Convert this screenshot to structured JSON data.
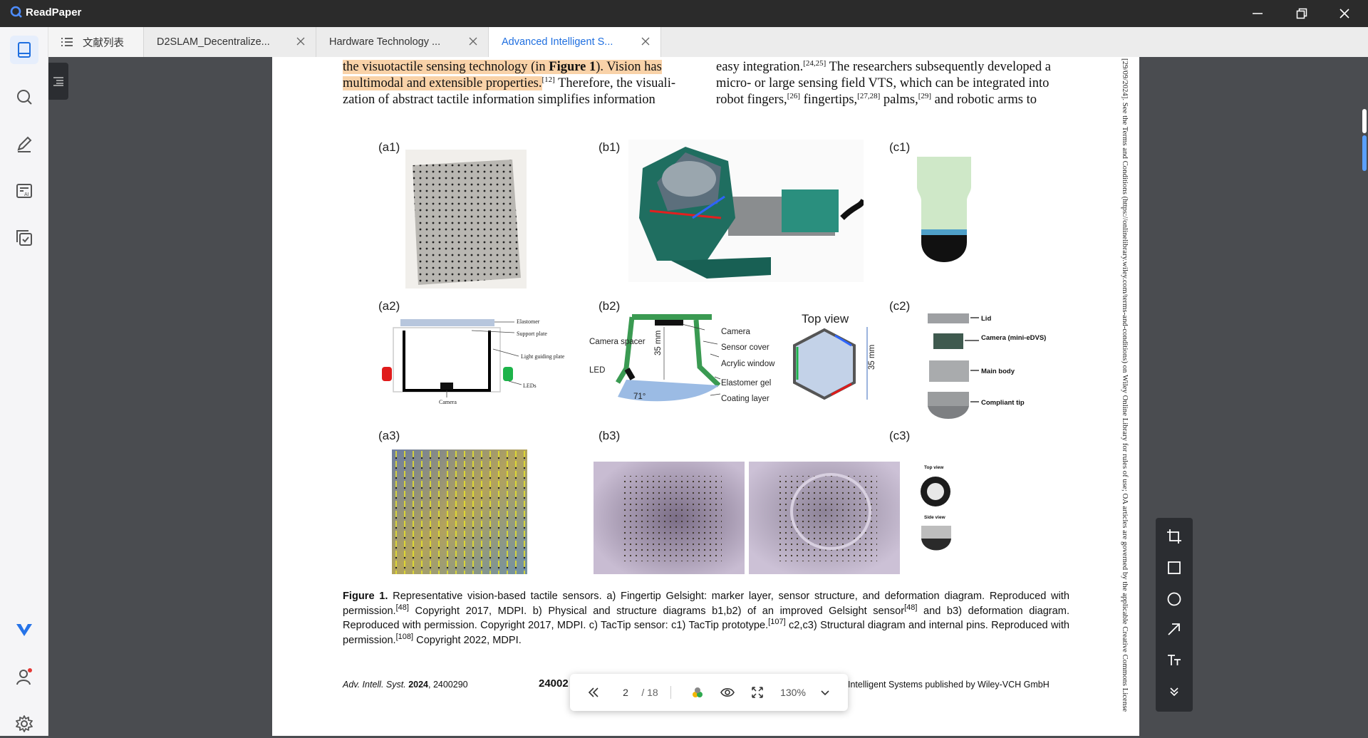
{
  "app": {
    "name": "ReadPaper"
  },
  "tabs": [
    {
      "label": "文献列表"
    },
    {
      "label": "D2SLAM_Decentralize..."
    },
    {
      "label": "Hardware Technology ..."
    },
    {
      "label": "Advanced Intelligent S..."
    }
  ],
  "paper": {
    "left_col": {
      "l1_hl": "the visuotactile sensing technology (in ",
      "l1_fig": "Figure 1",
      "l1_rest": "). Vision has",
      "l2_hl": "multimodal and extensible properties.",
      "l2_ref": "[12]",
      "l2_rest": " Therefore, the visuali-",
      "l3": "zation of abstract tactile information simplifies information"
    },
    "right_col": {
      "r1": "easy integration.",
      "r1_ref": "[24,25]",
      "r1_rest": " The researchers subsequently developed a",
      "r2": "micro- or large sensing field VTS, which can be integrated into",
      "r3a": "robot fingers,",
      "r3_ref1": "[26]",
      "r3b": " fingertips,",
      "r3_ref2": "[27,28]",
      "r3c": " palms,",
      "r3_ref3": "[29]",
      "r3d": " and robotic arms to"
    },
    "side_text": "[29/09/2024]. See the Terms and Conditions (https://onlinelibrary.wiley.com/terms-and-conditions) on Wiley Online Library for rules of use; OA articles are governed by the applicable Creative Commons License",
    "figure": {
      "labels": [
        "(a1)",
        "(b1)",
        "(c1)",
        "(a2)",
        "(b2)",
        "(c2)",
        "(a3)",
        "(b3)",
        "(c3)"
      ],
      "a2": [
        "Elastomer",
        "Support plate",
        "Light guiding plate",
        "LEDs",
        "Camera"
      ],
      "b2": [
        "Camera",
        "Sensor cover",
        "Acrylic window",
        "Elastomer gel",
        "Coating layer",
        "Camera spacer",
        "LED",
        "35 mm",
        "71°",
        "Top view",
        "35 mm"
      ],
      "c2": [
        "Lid",
        "Camera (mini-eDVS)",
        "Main body",
        "Compliant tip"
      ],
      "c3": [
        "Top view",
        "Side view"
      ]
    },
    "caption": {
      "label": "Figure 1.",
      "t1": " Representative vision-based tactile sensors. a) Fingertip Gelsight: marker layer, sensor structure, and deformation diagram. Reproduced with permission.",
      "ref1": "[48]",
      "t2": " Copyright 2017, MDPI. b) Physical and structure diagrams b1,b2) of an improved Gelsight sensor",
      "ref2": "[48]",
      "t3": " and b3) deformation diagram. Reproduced with permission. Copyright 2017, MDPI. c) TacTip sensor: c1) TacTip prototype.",
      "ref3": "[107]",
      "t4": " c2,c3) Structural diagram and internal pins. Reproduced with permission.",
      "ref4": "[108]",
      "t5": " Copyright 2022, MDPI."
    },
    "footer": {
      "journal": "Adv. Intell. Syst.",
      "year": "2024",
      "id": ", 2400290",
      "mid": "24002",
      "right": "Intelligent Systems published by Wiley-VCH GmbH"
    }
  },
  "pagebar": {
    "page": "2",
    "total": "/ 18",
    "zoom": "130%"
  },
  "colors": {
    "accent": "#1f6fe0",
    "highlight": "#f9d2a8",
    "titlebar": "#2b2b2b"
  }
}
